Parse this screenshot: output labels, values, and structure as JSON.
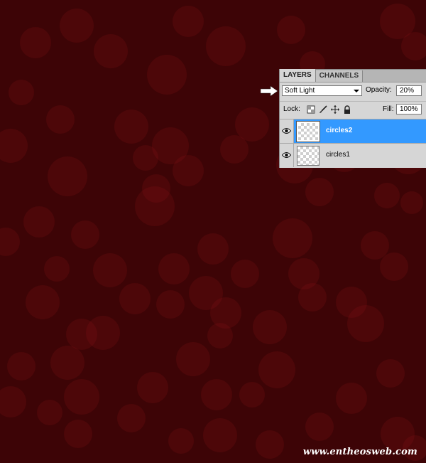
{
  "watermark": "www.entheosweb.com",
  "panel": {
    "tabs": [
      {
        "label": "LAYERS",
        "active": true
      },
      {
        "label": "CHANNELS",
        "active": false
      }
    ],
    "blend_mode": {
      "value": "Soft Light"
    },
    "opacity": {
      "label": "Opacity:",
      "value": "20%"
    },
    "lock": {
      "label": "Lock:",
      "icons": [
        "lock-transparent-icon",
        "lock-brush-icon",
        "lock-move-icon",
        "lock-all-icon"
      ]
    },
    "fill": {
      "label": "Fill:",
      "value": "100%"
    },
    "layers": [
      {
        "name": "circles2",
        "selected": true,
        "visible": true
      },
      {
        "name": "circles1",
        "selected": false,
        "visible": true
      }
    ]
  },
  "colors": {
    "canvas_background": "#3d0406",
    "bokeh": "#7a0f12",
    "selection": "#3399ff",
    "panel": "#d6d6d6"
  }
}
